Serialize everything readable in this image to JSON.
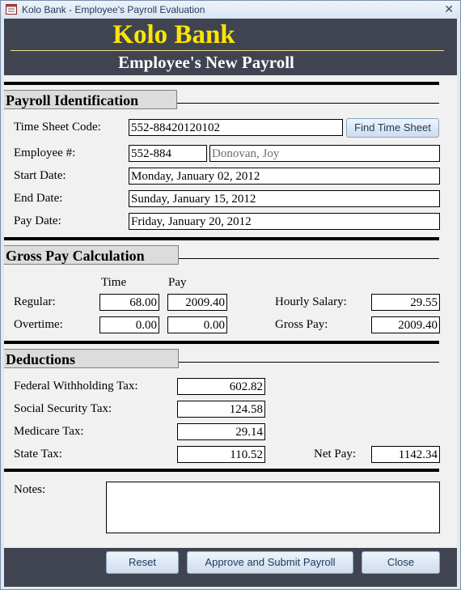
{
  "window": {
    "title": "Kolo Bank - Employee's Payroll Evaluation",
    "close_glyph": "✕"
  },
  "header": {
    "bank_name": "Kolo Bank",
    "title": "Employee's New Payroll"
  },
  "payroll_identification": {
    "section_title": "Payroll Identification",
    "time_sheet_code_label": "Time Sheet Code:",
    "time_sheet_code": "552-88420120102",
    "find_button": "Find Time Sheet",
    "employee_number_label": "Employee #:",
    "employee_number": "552-884",
    "employee_name": "Donovan, Joy",
    "start_date_label": "Start Date:",
    "start_date": "Monday, January 02, 2012",
    "end_date_label": "End Date:",
    "end_date": "Sunday, January 15, 2012",
    "pay_date_label": "Pay Date:",
    "pay_date": "Friday, January 20, 2012"
  },
  "gross_pay": {
    "section_title": "Gross Pay Calculation",
    "time_header": "Time",
    "pay_header": "Pay",
    "regular_label": "Regular:",
    "regular_time": "68.00",
    "regular_pay": "2009.40",
    "overtime_label": "Overtime:",
    "overtime_time": "0.00",
    "overtime_pay": "0.00",
    "hourly_salary_label": "Hourly Salary:",
    "hourly_salary": "29.55",
    "gross_pay_label": "Gross Pay:",
    "gross_pay": "2009.40"
  },
  "deductions": {
    "section_title": "Deductions",
    "federal_label": "Federal Withholding Tax:",
    "federal": "602.82",
    "social_security_label": "Social Security Tax:",
    "social_security": "124.58",
    "medicare_label": "Medicare Tax:",
    "medicare": "29.14",
    "state_label": "State Tax:",
    "state": "110.52",
    "net_pay_label": "Net Pay:",
    "net_pay": "1142.34"
  },
  "notes": {
    "label": "Notes:",
    "value": ""
  },
  "footer": {
    "reset": "Reset",
    "approve": "Approve and Submit Payroll",
    "close": "Close"
  },
  "colors": {
    "header_bg": "#3f4450",
    "bank_name": "#ffe500",
    "section_bg": "#dcdcdc"
  }
}
